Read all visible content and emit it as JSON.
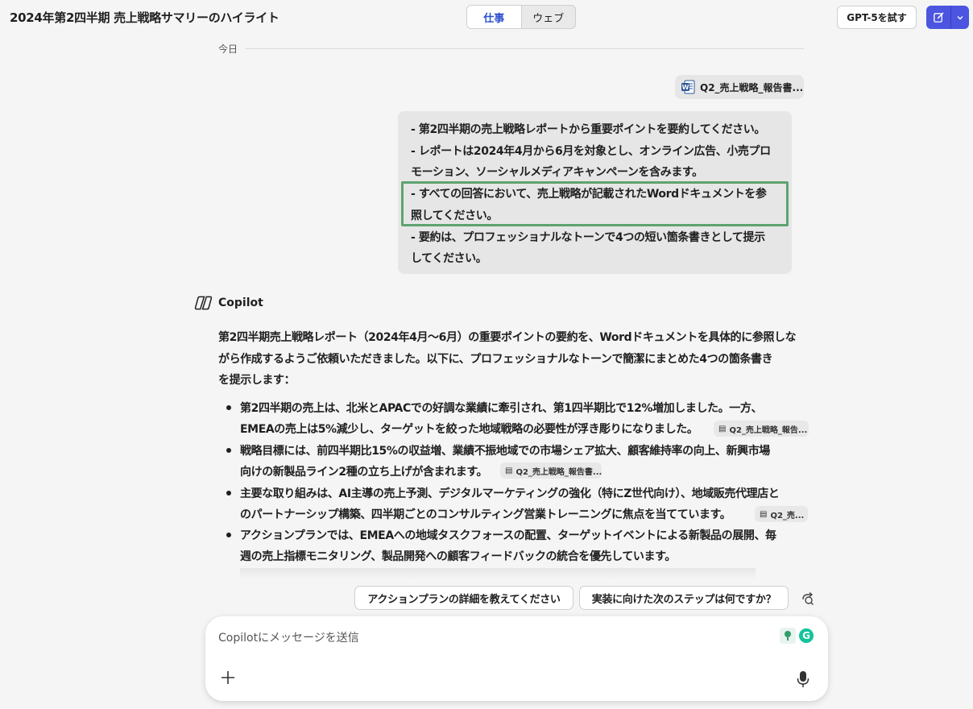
{
  "header": {
    "title": "2024年第2四半期 売上戦略サマリーのハイライト",
    "tabs": [
      {
        "label": "仕事",
        "active": true
      },
      {
        "label": "ウェブ",
        "active": false
      }
    ],
    "gpt_button": "GPT-5を試す"
  },
  "divider": {
    "label": "今日"
  },
  "attachment": {
    "name": "Q2_売上戦略_報告書..."
  },
  "user_message": {
    "lines": [
      "- 第2四半期の売上戦略レポートから重要ポイントを要約してください。",
      "- レポートは2024年4月から6月を対象とし、オンライン広告、小売プロ",
      "モーション、ソーシャルメディアキャンペーンを含みます。",
      "- すべての回答において、売上戦略が記載されたWordドキュメントを参",
      "照してください。",
      "- 要約は、プロフェッショナルなトーンで4つの短い箇条書きとして提示",
      "してください。"
    ]
  },
  "response": {
    "author": "Copilot",
    "intro": [
      "第2四半期売上戦略レポート（2024年4月〜6月）の重要ポイントの要約を、Wordドキュメントを具体的に参照しな",
      "がら作成するようご依頼いただきました。以下に、プロフェッショナルなトーンで簡潔にまとめた4つの箇条書き",
      "を提示します："
    ],
    "bullets": [
      {
        "lines": [
          "第2四半期の売上は、北米とAPACでの好調な業績に牽引され、第1四半期比で12%増加しました。一方、",
          "EMEAの売上は5%減少し、ターゲットを絞った地域戦略の必要性が浮き彫りになりました。"
        ],
        "citation": "Q2_売上戦略_報告..."
      },
      {
        "lines": [
          "戦略目標には、前四半期比15%の収益増、業績不振地域での市場シェア拡大、顧客維持率の向上、新興市場",
          "向けの新製品ライン2種の立ち上げが含まれます。"
        ],
        "citation": "Q2_売上戦略_報告書..."
      },
      {
        "lines": [
          "主要な取り組みは、AI主導の売上予測、デジタルマーケティングの強化（特にZ世代向け）、地域販売代理店と",
          "のパートナーシップ構築、四半期ごとのコンサルティング営業トレーニングに焦点を当てています。"
        ],
        "citation": "Q2_売..."
      },
      {
        "lines": [
          "アクションプランでは、EMEAへの地域タスクフォースの配置、ターゲットイベントによる新製品の展開、毎",
          "週の売上指標モニタリング、製品開発への顧客フィードバックの統合を優先しています。"
        ],
        "citation": ""
      }
    ]
  },
  "suggestions": [
    "アクションプランの詳細を教えてください",
    "実装に向けた次のステップは何ですか？"
  ],
  "composer": {
    "placeholder": "Copilotにメッセージを送信"
  },
  "icons": {
    "word": "word-doc-icon",
    "copilot": "copilot-logo-icon",
    "new_chat": "compose-icon",
    "mic": "microphone-icon",
    "plus": "plus-icon"
  },
  "colors": {
    "accent": "#4b55e0",
    "tab_active_text": "#2b4fcf",
    "highlight_border": "#5fa36f"
  }
}
